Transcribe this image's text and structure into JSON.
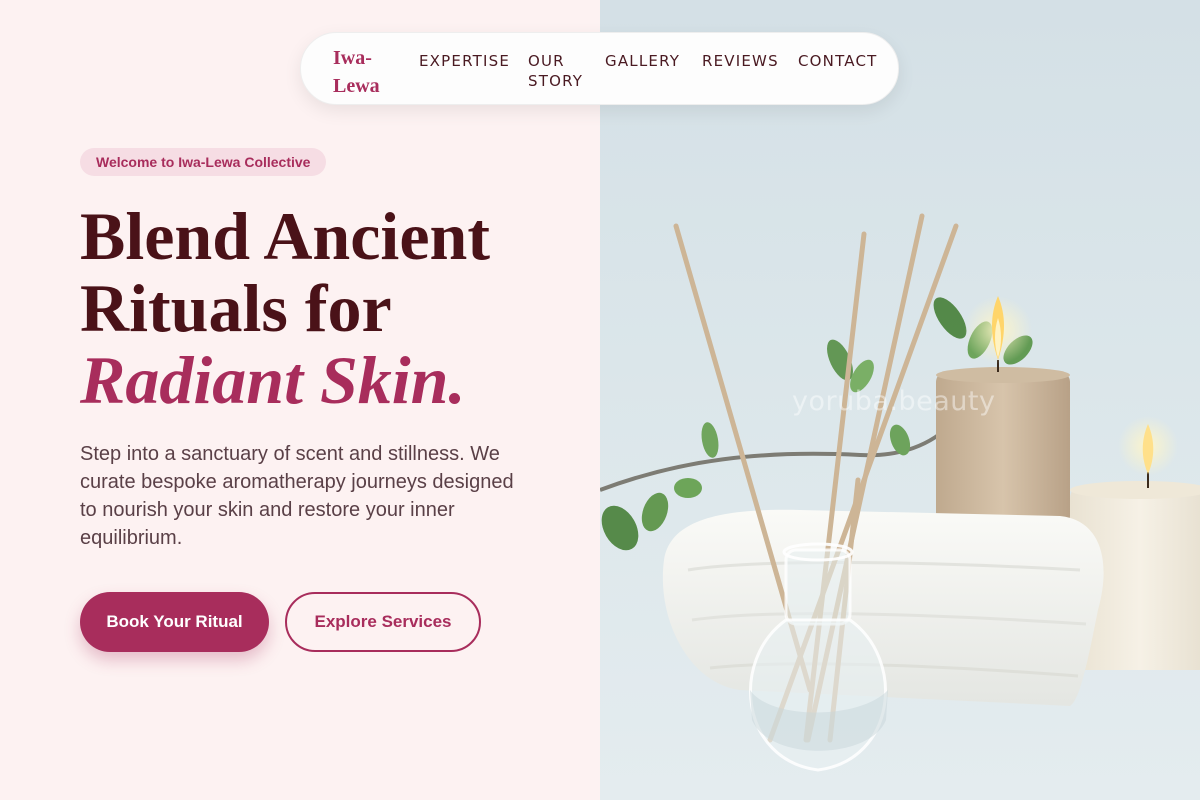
{
  "brand": {
    "name": "Iwa-Lewa"
  },
  "nav": {
    "items": [
      {
        "id": "expertise",
        "label": "EXPERTISE"
      },
      {
        "id": "our-story",
        "label": "OUR STORY"
      },
      {
        "id": "gallery",
        "label": "GALLERY"
      },
      {
        "id": "reviews",
        "label": "REVIEWS"
      },
      {
        "id": "contact",
        "label": "CONTACT"
      }
    ]
  },
  "hero": {
    "badge": "Welcome to Iwa-Lewa Collective",
    "headline_line1": "Blend Ancient",
    "headline_line2": "Rituals for",
    "headline_accent": "Radiant Skin.",
    "description": "Step into a sanctuary of scent and stillness. We curate bespoke aromatherapy journeys designed to nourish your skin and restore your inner equilibrium.",
    "primary_cta": "Book Your Ritual",
    "secondary_cta": "Explore Services"
  },
  "image": {
    "watermark": "yoruba.beauty",
    "subject": "reed-diffuser-candles-towel-photo"
  },
  "colors": {
    "accent": "#a82d5c",
    "heading": "#4a1218",
    "background": "#fdf2f2"
  }
}
